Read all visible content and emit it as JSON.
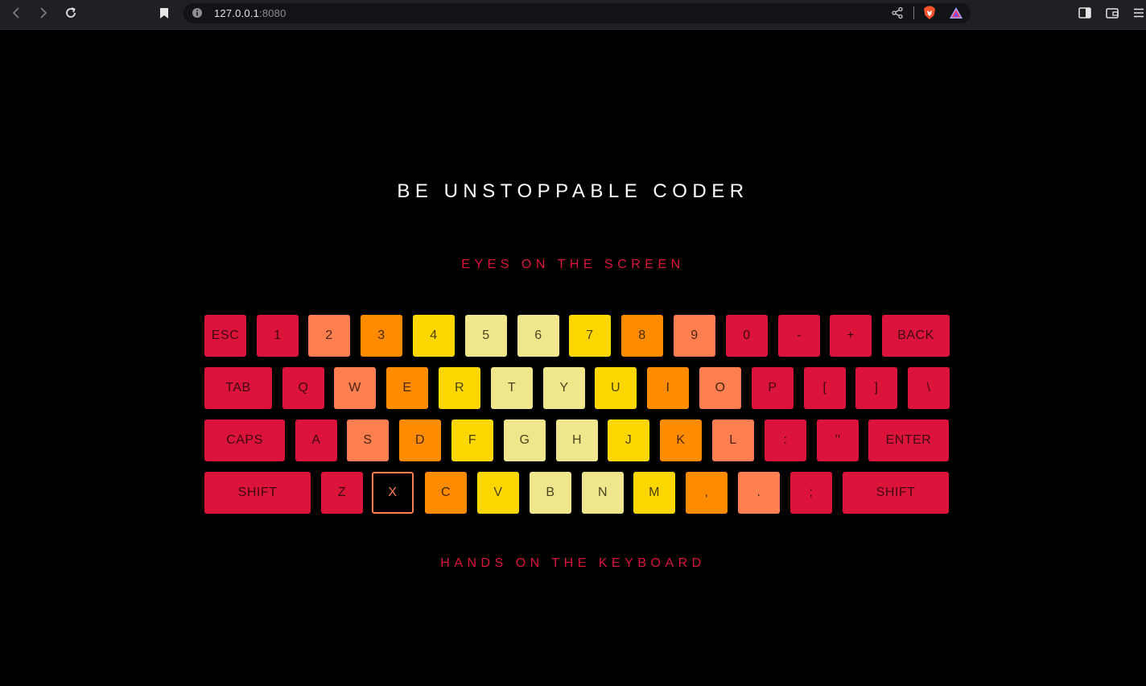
{
  "browser": {
    "url_host": "127.0.0.1",
    "url_port": ":8080"
  },
  "page": {
    "title": "BE UNSTOPPABLE CODER",
    "subtitle_top": "EYES ON THE SCREEN",
    "subtitle_bottom": "HANDS ON THE KEYBOARD"
  },
  "colors": {
    "crimson": "#dc143c",
    "coral": "#ff7f50",
    "orange": "#ff8c00",
    "gold": "#ffd700",
    "khaki": "#f0e68c",
    "background": "#000000"
  },
  "keyboard": {
    "rows": [
      [
        {
          "label": "ESC",
          "color": "crimson"
        },
        {
          "label": "1",
          "color": "crimson"
        },
        {
          "label": "2",
          "color": "coral"
        },
        {
          "label": "3",
          "color": "orange"
        },
        {
          "label": "4",
          "color": "gold"
        },
        {
          "label": "5",
          "color": "khaki"
        },
        {
          "label": "6",
          "color": "khaki"
        },
        {
          "label": "7",
          "color": "gold"
        },
        {
          "label": "8",
          "color": "orange"
        },
        {
          "label": "9",
          "color": "coral"
        },
        {
          "label": "0",
          "color": "crimson"
        },
        {
          "label": "-",
          "color": "crimson"
        },
        {
          "label": "+",
          "color": "crimson"
        },
        {
          "label": "BACK",
          "color": "crimson"
        }
      ],
      [
        {
          "label": "TAB",
          "color": "crimson"
        },
        {
          "label": "Q",
          "color": "crimson"
        },
        {
          "label": "W",
          "color": "coral"
        },
        {
          "label": "E",
          "color": "orange"
        },
        {
          "label": "R",
          "color": "gold"
        },
        {
          "label": "T",
          "color": "khaki"
        },
        {
          "label": "Y",
          "color": "khaki"
        },
        {
          "label": "U",
          "color": "gold"
        },
        {
          "label": "I",
          "color": "orange"
        },
        {
          "label": "O",
          "color": "coral"
        },
        {
          "label": "P",
          "color": "crimson"
        },
        {
          "label": "[",
          "color": "crimson"
        },
        {
          "label": "]",
          "color": "crimson"
        },
        {
          "label": "\\",
          "color": "crimson"
        }
      ],
      [
        {
          "label": "CAPS",
          "color": "crimson"
        },
        {
          "label": "A",
          "color": "crimson"
        },
        {
          "label": "S",
          "color": "coral"
        },
        {
          "label": "D",
          "color": "orange"
        },
        {
          "label": "F",
          "color": "gold"
        },
        {
          "label": "G",
          "color": "khaki"
        },
        {
          "label": "H",
          "color": "khaki"
        },
        {
          "label": "J",
          "color": "gold"
        },
        {
          "label": "K",
          "color": "orange"
        },
        {
          "label": "L",
          "color": "coral"
        },
        {
          "label": ":",
          "color": "crimson"
        },
        {
          "label": "''",
          "color": "crimson"
        },
        {
          "label": "ENTER",
          "color": "crimson"
        }
      ],
      [
        {
          "label": "SHIFT",
          "color": "crimson"
        },
        {
          "label": "Z",
          "color": "crimson"
        },
        {
          "label": "X",
          "color": "active"
        },
        {
          "label": "C",
          "color": "orange"
        },
        {
          "label": "V",
          "color": "gold"
        },
        {
          "label": "B",
          "color": "khaki"
        },
        {
          "label": "N",
          "color": "khaki"
        },
        {
          "label": "M",
          "color": "gold"
        },
        {
          "label": ",",
          "color": "orange"
        },
        {
          "label": ".",
          "color": "coral"
        },
        {
          "label": ";",
          "color": "crimson"
        },
        {
          "label": "SHIFT",
          "color": "crimson"
        }
      ]
    ]
  }
}
